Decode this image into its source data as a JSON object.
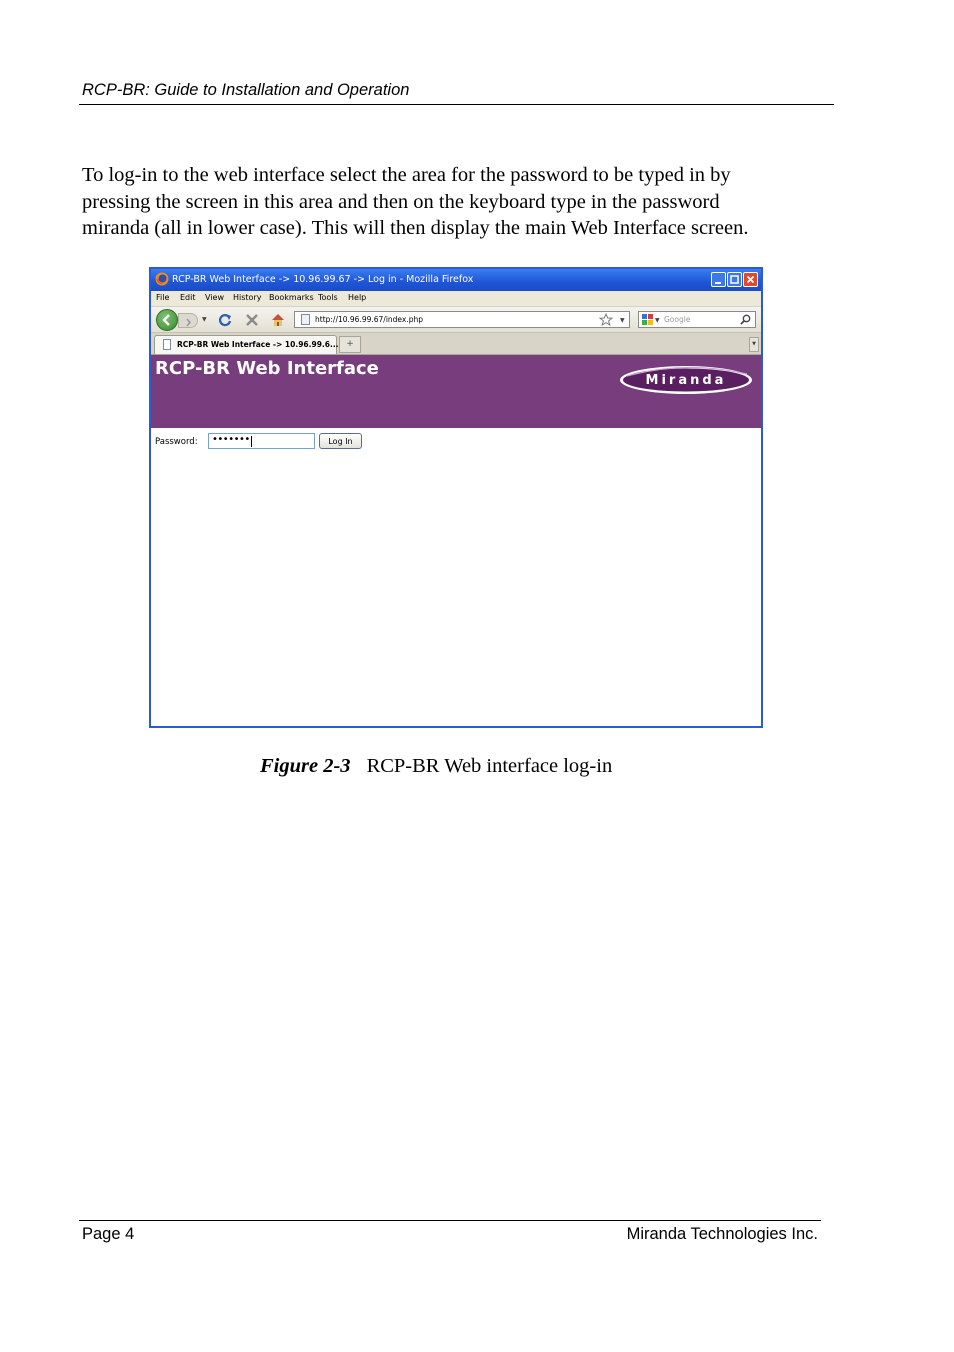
{
  "header": {
    "title": "RCP-BR: Guide to Installation and Operation"
  },
  "intro": {
    "lines": [
      "To log-in to the web interface select the area for the password to be typed in by",
      "pressing the screen in this area and then on the keyboard type in the password",
      "miranda (all in lower case).  This will then display the main Web Interface screen."
    ]
  },
  "browser": {
    "window_title": "RCP-BR Web Interface -> 10.96.99.67 -> Log in - Mozilla Firefox",
    "menu": [
      "File",
      "Edit",
      "View",
      "History",
      "Bookmarks",
      "Tools",
      "Help"
    ],
    "url": "http://10.96.99.67/index.php",
    "search_placeholder": "Google",
    "tab_label": "RCP-BR Web Interface -> 10.96.99.6...",
    "new_tab_glyph": "+",
    "banner_title": "RCP-BR Web Interface",
    "logo_text": "Miranda",
    "password_label": "Password:",
    "password_value": "•••••••",
    "login_button": "Log In",
    "icons": [
      "firefox-icon",
      "back-icon",
      "forward-icon",
      "reload-icon",
      "stop-icon",
      "home-icon",
      "bookmark-star-icon",
      "google-icon",
      "search-icon"
    ],
    "colors": {
      "banner": "#773d7c",
      "titlebar": "#1f55d6"
    }
  },
  "caption": {
    "label": "Figure 2-3",
    "text": "RCP-BR Web interface log-in"
  },
  "footer": {
    "left": "Page 4",
    "right": "Miranda Technologies Inc."
  }
}
